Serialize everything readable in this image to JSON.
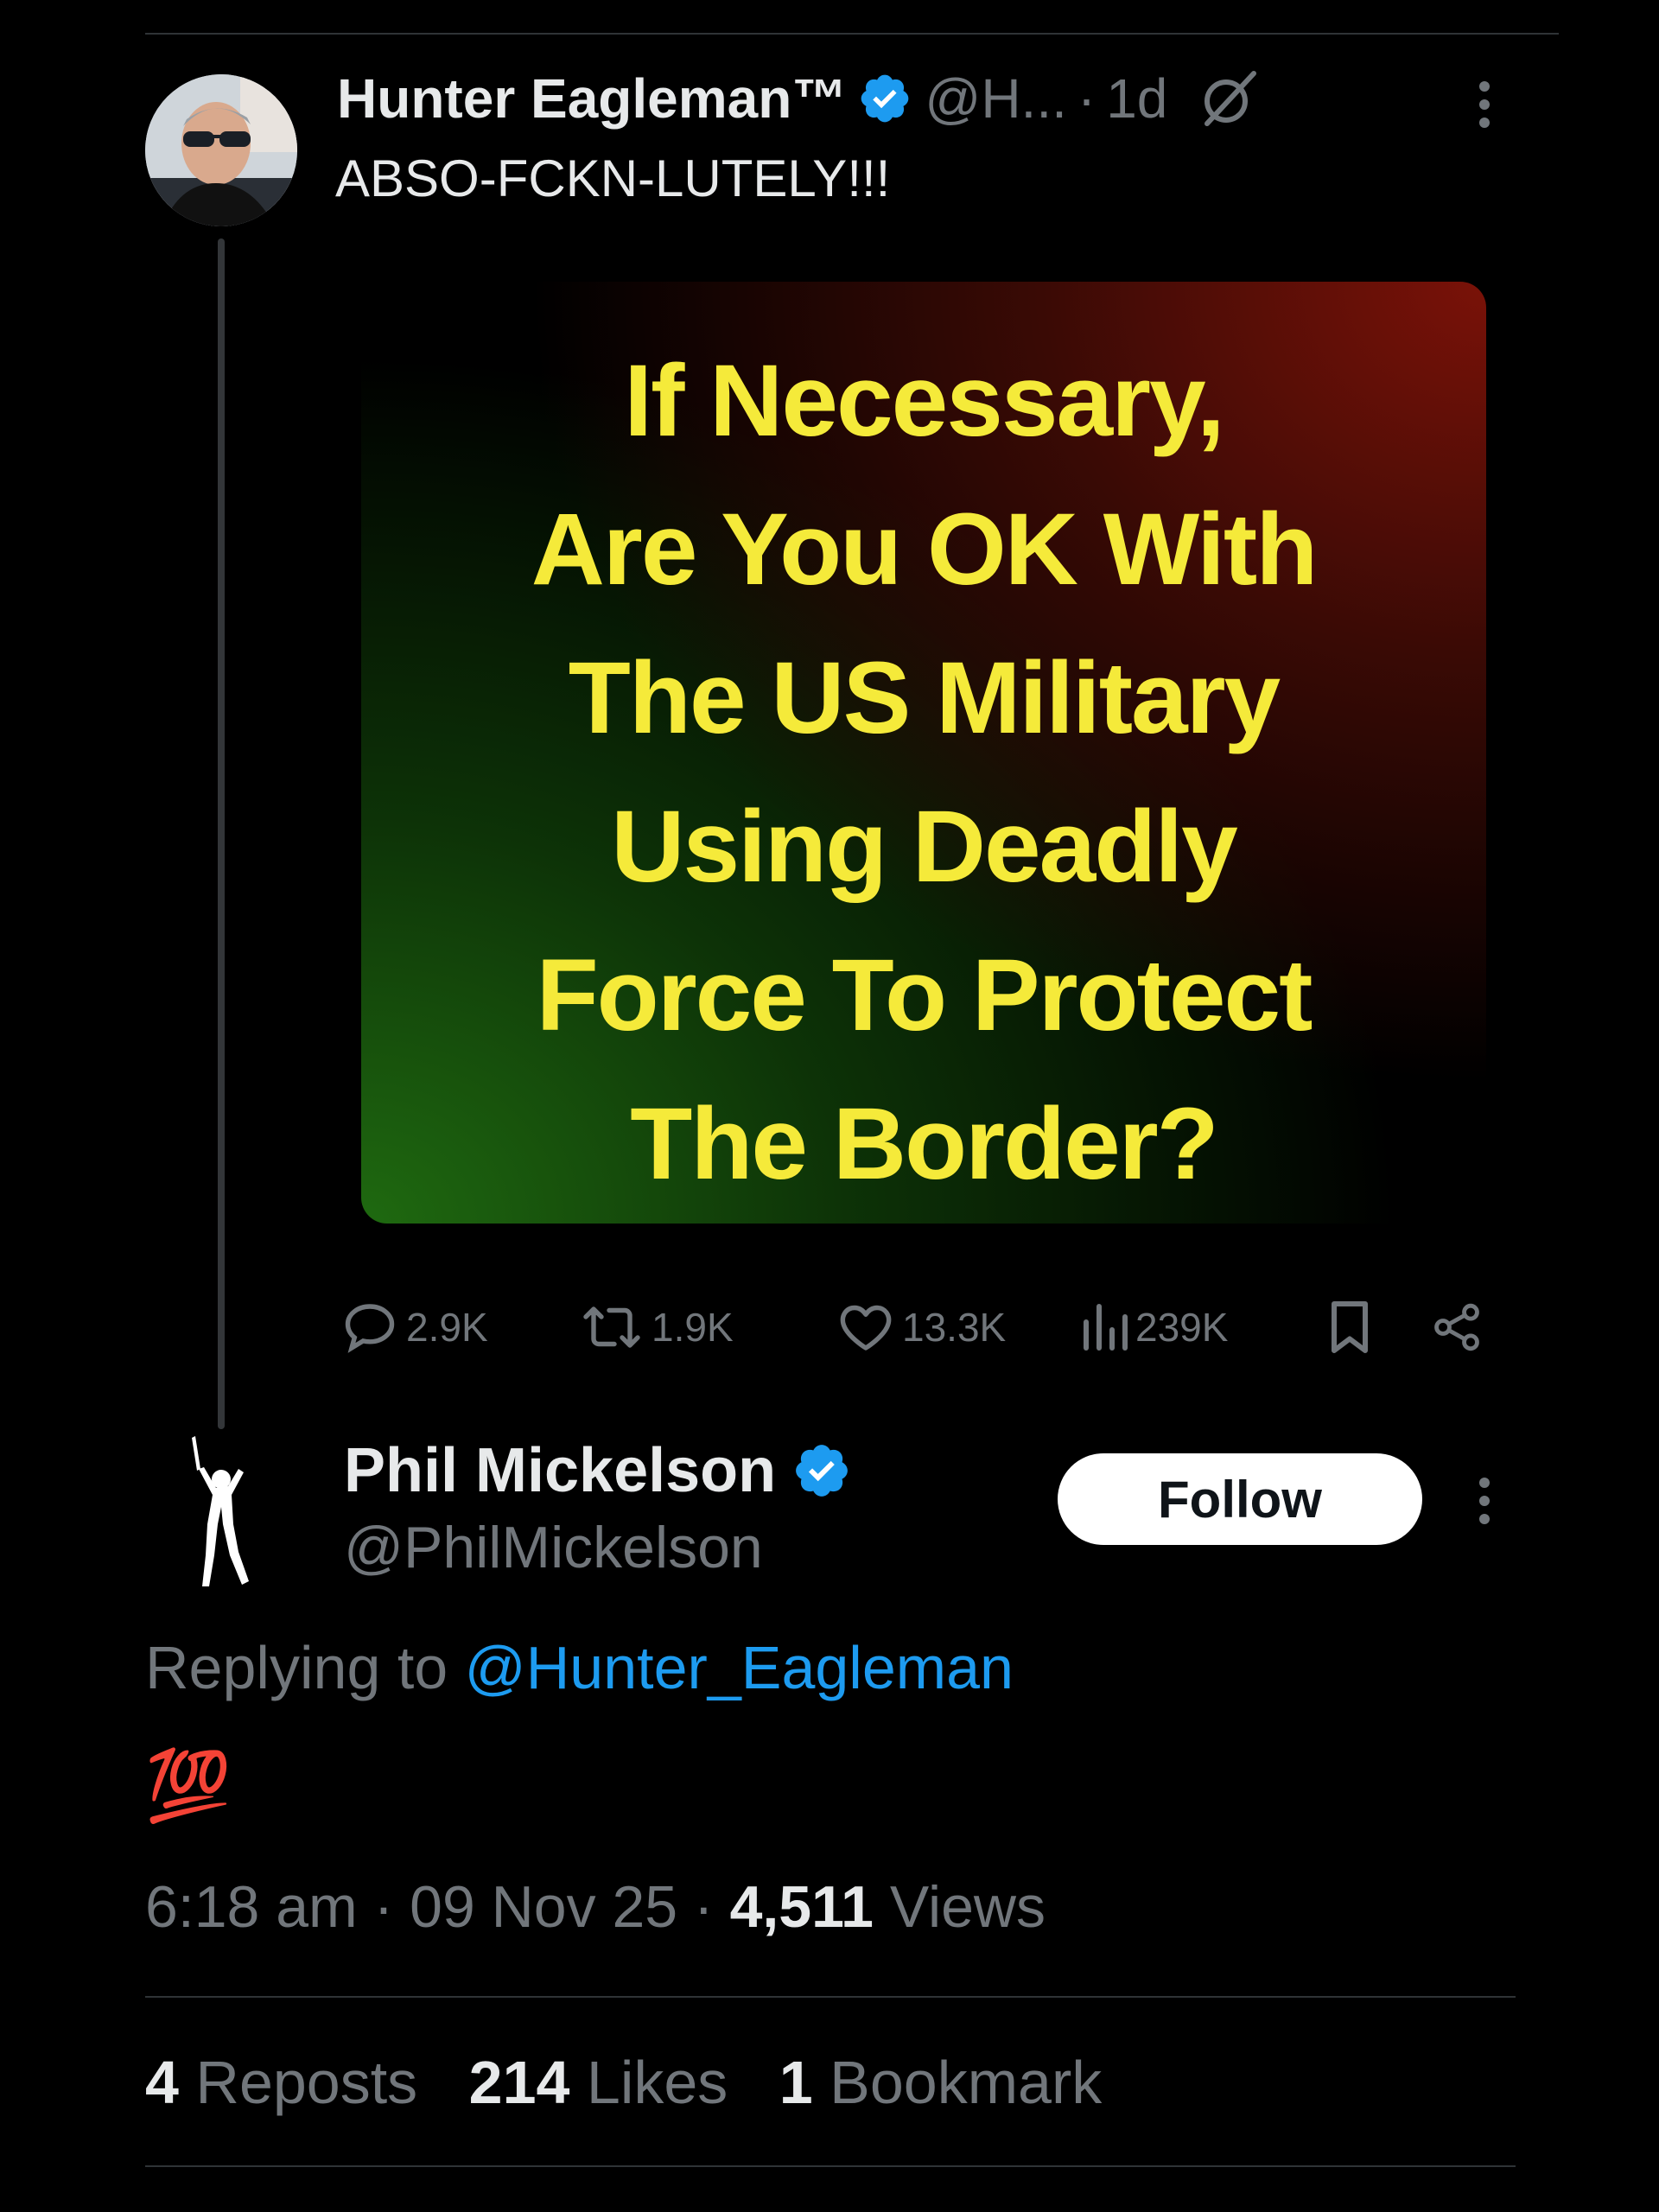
{
  "colors": {
    "background": "#000000",
    "text": "#e7e9ea",
    "muted": "#71767b",
    "link": "#1d9bf0",
    "verified": "#1d9bf0",
    "image_text": "#f5ea3a"
  },
  "original_tweet": {
    "author_name": "Hunter Eagleman™",
    "handle": "@H...",
    "separator": "·",
    "time": "1d",
    "text": "ABSO-FCKN-LUTELY!!!",
    "image_text": [
      "If Necessary,",
      "Are You OK With",
      "The US Military",
      "Using Deadly",
      "Force To Protect",
      "The Border?"
    ],
    "stats": {
      "replies": "2.9K",
      "reposts": "1.9K",
      "likes": "13.3K",
      "views": "239K"
    }
  },
  "reply": {
    "author_name": "Phil Mickelson",
    "handle": "@PhilMickelson",
    "follow_label": "Follow",
    "replying_prefix": "Replying to ",
    "replying_handle": "@Hunter_Eagleman",
    "text": "💯",
    "time": "6:18 am",
    "sep1": " · ",
    "date": "09 Nov 25",
    "sep2": " · ",
    "views_count": "4,511",
    "views_label": " Views",
    "reposts_count": "4",
    "reposts_label": " Reposts",
    "likes_count": "214",
    "likes_label": " Likes",
    "bookmarks_count": "1",
    "bookmarks_label": " Bookmark"
  }
}
